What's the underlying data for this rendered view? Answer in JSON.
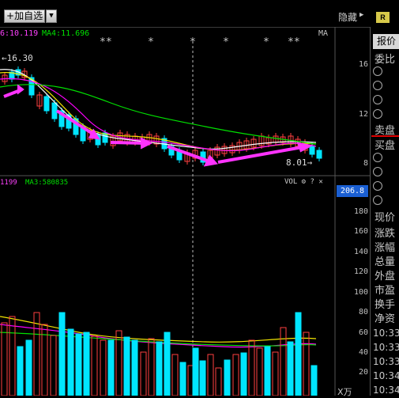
{
  "toolbar": {
    "add_label": "加自选",
    "add_plus": "+",
    "dropdown_arrow": "▼",
    "hide_label": "隐藏",
    "hide_arrow": "▶",
    "r_badge": "R"
  },
  "ma_legend": {
    "partial_value": "6:10.119",
    "ma4_label": "MA4:11.696",
    "right_label": "MA"
  },
  "signal_stars": [
    "**",
    "*",
    "*",
    "*",
    "*",
    "**"
  ],
  "price_axis": [
    "16",
    "12",
    "8"
  ],
  "annotations": {
    "high": "←16.30",
    "low": "8.01→"
  },
  "volume": {
    "legend_partial": "1199",
    "ma3_label": "MA3:580835",
    "controls": "VOL ⚙ ? ✕",
    "current_box": "206.8",
    "axis": [
      "180",
      "160",
      "140",
      "120",
      "100",
      "80",
      "60",
      "40",
      "20"
    ],
    "unit": "X万"
  },
  "quote_panel": {
    "tab_label": "报价",
    "rows_top": [
      "委比"
    ],
    "sell_label": "卖盘",
    "buy_label": "买盘",
    "fields": [
      "现价",
      "涨跌",
      "涨幅",
      "总量",
      "外盘",
      "市盈",
      "换手",
      "净资"
    ],
    "times": [
      "10:33",
      "10:33",
      "10:33",
      "10:34",
      "10:34"
    ]
  },
  "colors": {
    "background": "#000000",
    "candle_up": "#ff4040",
    "candle_down": "#00e5ff",
    "ma_white": "#ffffff",
    "ma_yellow": "#f2e600",
    "ma_magenta": "#ff00ff",
    "ma_green": "#00e000",
    "arrow": "#ff33ff",
    "vol_box": "#1a5fd3"
  }
}
